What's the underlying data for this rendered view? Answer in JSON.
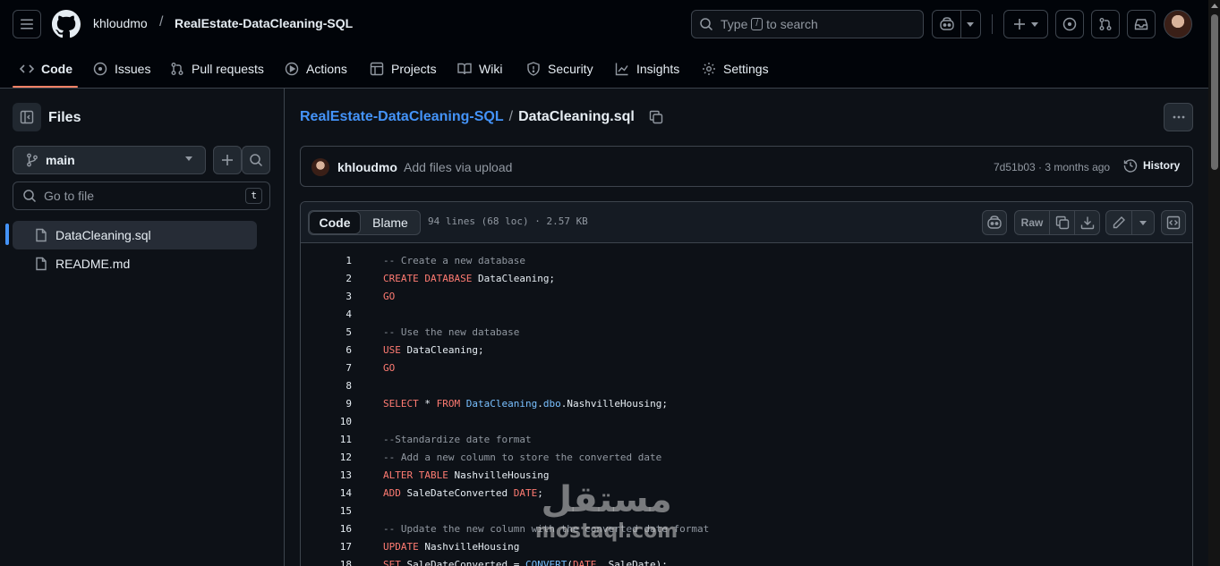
{
  "header": {
    "owner": "khloudmo",
    "separator": "/",
    "repo": "RealEstate-DataCleaning-SQL",
    "search_prefix": "Type",
    "search_key": "/",
    "search_suffix": "to search"
  },
  "repo_nav": {
    "tabs": [
      {
        "label": "Code",
        "icon": "code-icon",
        "active": true
      },
      {
        "label": "Issues",
        "icon": "issue-icon"
      },
      {
        "label": "Pull requests",
        "icon": "pull-request-icon"
      },
      {
        "label": "Actions",
        "icon": "play-icon"
      },
      {
        "label": "Projects",
        "icon": "table-icon"
      },
      {
        "label": "Wiki",
        "icon": "book-icon"
      },
      {
        "label": "Security",
        "icon": "shield-icon"
      },
      {
        "label": "Insights",
        "icon": "graph-icon"
      },
      {
        "label": "Settings",
        "icon": "gear-icon"
      }
    ]
  },
  "sidebar": {
    "title": "Files",
    "branch": "main",
    "goto_placeholder": "Go to file",
    "goto_shortcut": "t",
    "files": [
      {
        "name": "DataCleaning.sql",
        "selected": true
      },
      {
        "name": "README.md",
        "selected": false
      }
    ]
  },
  "file": {
    "repo_link": "RealEstate-DataCleaning-SQL",
    "separator": "/",
    "name": "DataCleaning.sql"
  },
  "commit": {
    "author": "khloudmo",
    "message": "Add files via upload",
    "meta": "7d51b03 · 3 months ago",
    "history_label": "History"
  },
  "code_view": {
    "tab_code": "Code",
    "tab_blame": "Blame",
    "stats": "94 lines (68 loc) · 2.57 KB",
    "raw_label": "Raw"
  },
  "code": {
    "lines": [
      [
        [
          "comment",
          "-- Create a new database"
        ]
      ],
      [
        [
          "kw",
          "CREATE DATABASE"
        ],
        [
          "plain",
          " DataCleaning;"
        ]
      ],
      [
        [
          "kw",
          "GO"
        ]
      ],
      [],
      [
        [
          "comment",
          "-- Use the new database"
        ]
      ],
      [
        [
          "kw",
          "USE"
        ],
        [
          "plain",
          " DataCleaning;"
        ]
      ],
      [
        [
          "kw",
          "GO"
        ]
      ],
      [],
      [
        [
          "kw",
          "SELECT"
        ],
        [
          "plain",
          " * "
        ],
        [
          "kw",
          "FROM"
        ],
        [
          "plain",
          " "
        ],
        [
          "ent",
          "DataCleaning"
        ],
        [
          "plain",
          "."
        ],
        [
          "ent",
          "dbo"
        ],
        [
          "plain",
          ".NashvilleHousing;"
        ]
      ],
      [],
      [
        [
          "comment",
          "--Standardize date format"
        ]
      ],
      [
        [
          "comment",
          "-- Add a new column to store the converted date"
        ]
      ],
      [
        [
          "kw",
          "ALTER TABLE"
        ],
        [
          "plain",
          " NashvilleHousing"
        ]
      ],
      [
        [
          "kw",
          "ADD"
        ],
        [
          "plain",
          " SaleDateConverted "
        ],
        [
          "kw",
          "DATE"
        ],
        [
          "plain",
          ";"
        ]
      ],
      [],
      [
        [
          "comment",
          "-- Update the new column with the converted date format"
        ]
      ],
      [
        [
          "kw",
          "UPDATE"
        ],
        [
          "plain",
          " NashvilleHousing"
        ]
      ],
      [
        [
          "kw",
          "SET"
        ],
        [
          "plain",
          " SaleDateConverted = "
        ],
        [
          "ent",
          "CONVERT"
        ],
        [
          "plain",
          "("
        ],
        [
          "kw",
          "DATE"
        ],
        [
          "plain",
          ", SaleDate);"
        ]
      ]
    ]
  },
  "watermark": {
    "arabic": "مستقل",
    "latin": "mostaql.com"
  },
  "colors": {
    "background": "#0d1117",
    "header": "#010409",
    "border": "#3d444d",
    "link": "#4493f8",
    "accent_underline": "#f78166",
    "keyword": "#ff7b72",
    "entity": "#79c0ff",
    "comment": "#9198a1"
  }
}
